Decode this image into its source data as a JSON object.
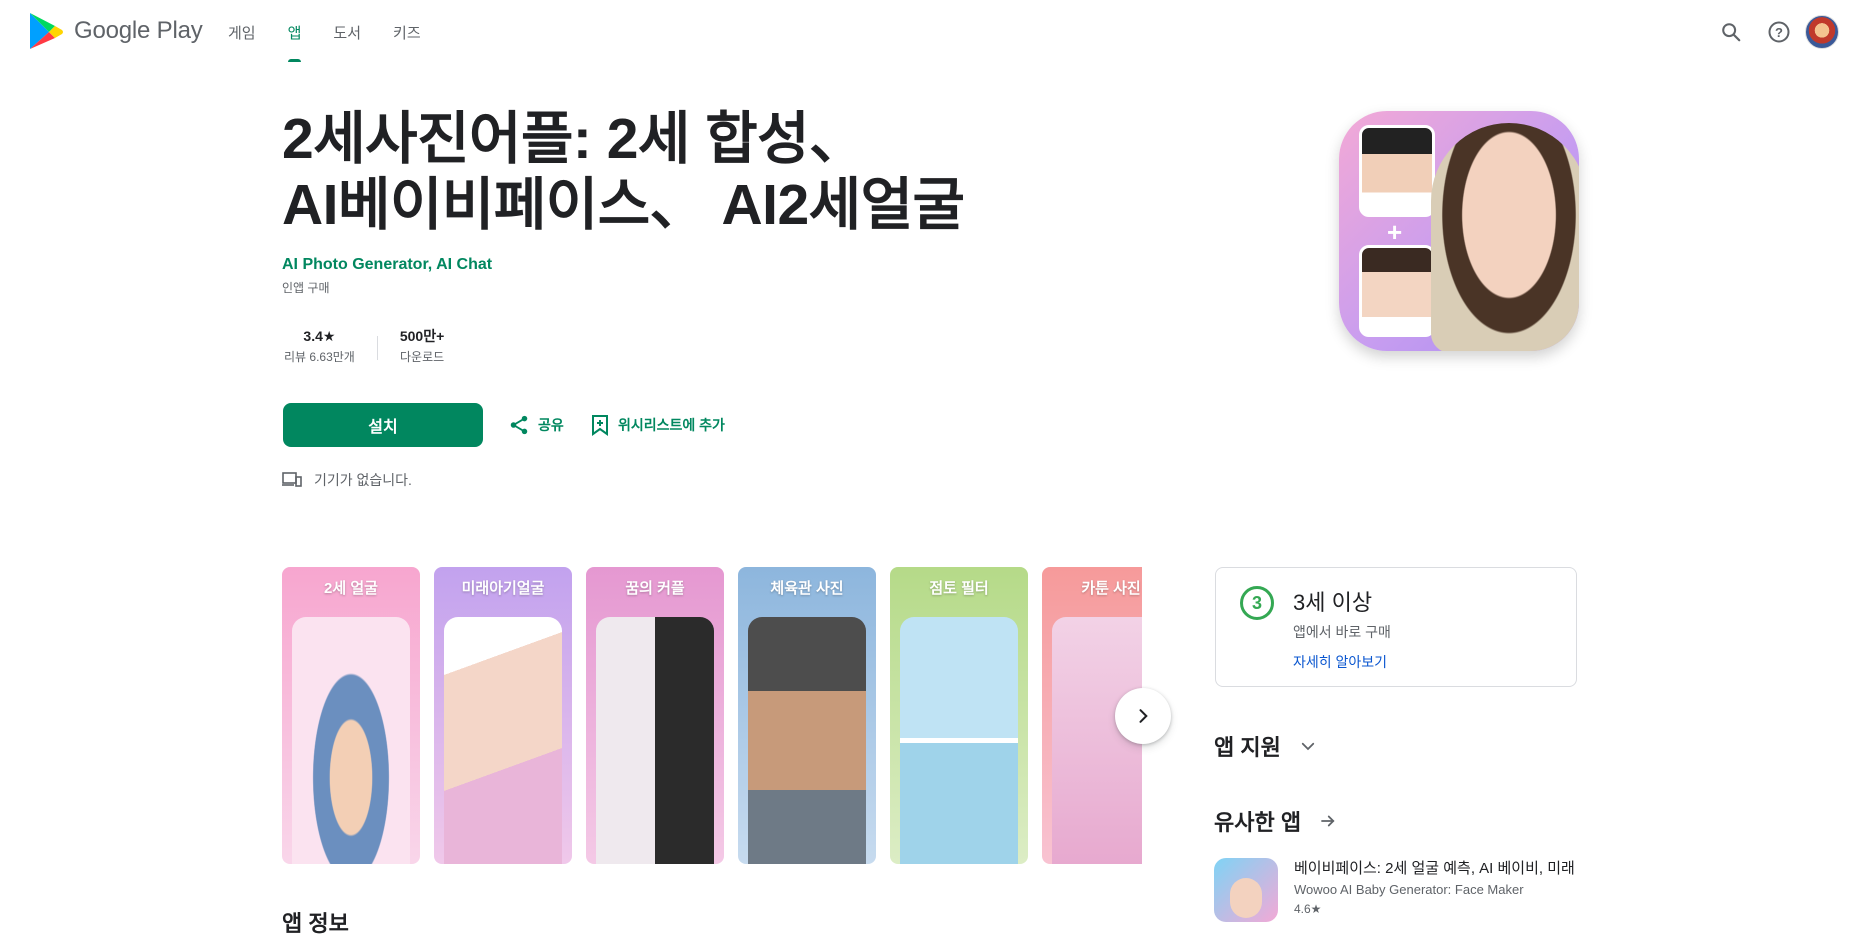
{
  "header": {
    "brand": "Google Play",
    "nav": [
      "게임",
      "앱",
      "도서",
      "키즈"
    ],
    "active_nav": "앱",
    "icons": [
      "search-icon",
      "help-icon",
      "account-avatar"
    ]
  },
  "app": {
    "title_line1": "2세사진어플: 2세 합성、",
    "title_line2": "AI베이비페이스、 AI2세얼굴",
    "developer": "AI Photo Generator, AI Chat",
    "in_app": "인앱 구매",
    "rating_value": "3.4★",
    "rating_label": "리뷰 6.63만개",
    "downloads_value": "500만+",
    "downloads_label": "다운로드",
    "install_label": "설치",
    "share_label": "공유",
    "wishlist_label": "위시리스트에 추가",
    "device_note": "기기가 없습니다."
  },
  "screenshots": [
    {
      "caption": "2세 얼굴",
      "bg": "#f6a8d0"
    },
    {
      "caption": "미래아기얼굴",
      "bg": "#c4a3ee"
    },
    {
      "caption": "꿈의 커플",
      "bg": "#e79fd4"
    },
    {
      "caption": "체육관 사진",
      "bg": "#8fb8de"
    },
    {
      "caption": "점토 필터",
      "bg": "#b7dc8c"
    },
    {
      "caption": "카툰 사진",
      "bg": "#f59a9a"
    }
  ],
  "sections": {
    "app_info_peek": "앱 정보"
  },
  "rating_card": {
    "badge": "3",
    "title": "3세 이상",
    "subtitle": "앱에서 바로 구매",
    "link": "자세히 알아보기"
  },
  "sidebar": {
    "support": "앱 지원",
    "similar": "유사한 앱",
    "similar_item": {
      "name": "베이비페이스: 2세 얼굴 예측, AI 베이비, 미래",
      "developer": "Wowoo AI Baby Generator: Face Maker",
      "rating": "4.6★"
    }
  },
  "colors": {
    "accent": "#01875f",
    "link": "#0b57d0",
    "rating_badge": "#34a853"
  }
}
